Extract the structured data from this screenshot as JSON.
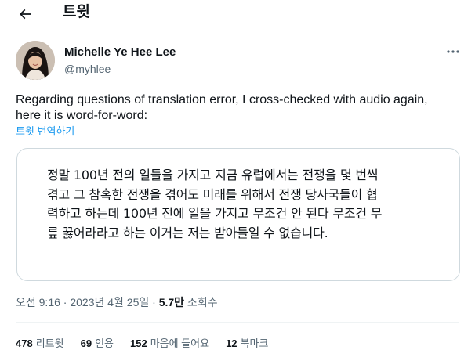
{
  "header": {
    "title": "트윗"
  },
  "tweet": {
    "author_name": "Michelle Ye Hee Lee",
    "author_handle": "@myhlee",
    "text": "Regarding questions of translation error, I cross-checked with audio again, here it is word-for-word:",
    "translate_label": "트윗 번역하기",
    "quote_text": "정말 100년 전의 일들을 가지고 지금 유럽에서는 전쟁을 몇 번씩 겪고 그 참혹한 전쟁을 겪어도 미래를 위해서 전쟁 당사국들이 협력하고 하는데 100년 전에 일을 가지고 무조건 안 된다 무조건 무릎 꿇어라라고 하는 이거는 저는 받아들일 수 없습니다.",
    "quote_lines": [
      "정말 100년 전의 일들을 가지고 지금 유럽에서는 전쟁을 몇 번씩",
      "겪고 그 참혹한 전쟁을 겪어도 미래를 위해서 전쟁 당사국들이 협",
      "력하고 하는데 100년 전에 일을 가지고 무조건 안 된다 무조건 무",
      "릎 꿇어라라고 하는 이거는 저는 받아들일 수 없습니다."
    ],
    "timestamp": "오전 9:16 · 2023년 4월 25일 · ",
    "views_count": "5.7만",
    "views_label": " 조회수"
  },
  "stats": [
    {
      "count": "478",
      "label": "리트윗"
    },
    {
      "count": "69",
      "label": "인용"
    },
    {
      "count": "152",
      "label": "마음에 들어요"
    },
    {
      "count": "12",
      "label": "북마크"
    }
  ],
  "icons": {
    "back": "back-arrow-icon",
    "more": "more-options-icon"
  },
  "colors": {
    "link": "#1d9bf0",
    "secondary_text": "#536471",
    "primary_text": "#0f1419",
    "border": "#cfd9de"
  }
}
